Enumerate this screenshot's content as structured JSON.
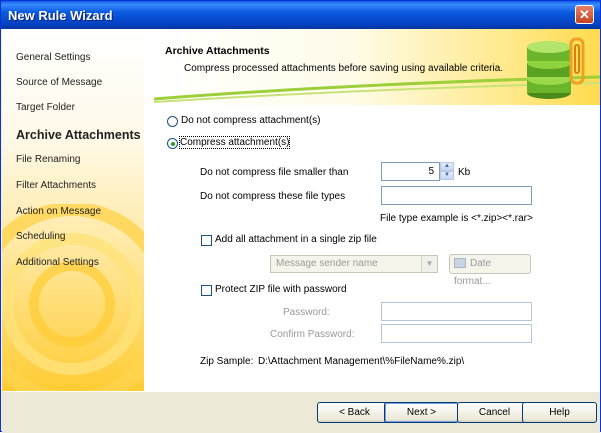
{
  "window": {
    "title": "New Rule Wizard",
    "close_glyph": "✕"
  },
  "sidebar": {
    "items": [
      {
        "label": "General Settings"
      },
      {
        "label": "Source of Message"
      },
      {
        "label": "Target Folder"
      },
      {
        "label": "Archive Attachments",
        "active": true
      },
      {
        "label": "File Renaming"
      },
      {
        "label": "Filter Attachments"
      },
      {
        "label": "Action on Message"
      },
      {
        "label": "Scheduling"
      },
      {
        "label": "Additional Settings"
      }
    ]
  },
  "header": {
    "title": "Archive Attachments",
    "subtitle": "Compress processed attachments before saving using available criteria.",
    "icon": "archive-books-icon"
  },
  "options": {
    "no_compress_label": "Do not compress attachment(s)",
    "compress_label": "Compress attachment(s)",
    "selected": "compress",
    "min_size_label": "Do not compress file smaller than",
    "min_size_value": "5",
    "min_size_unit": "Kb",
    "exclude_types_label": "Do not compress these file types",
    "exclude_types_value": "",
    "file_type_hint": "File type example is <*.zip><*.rar>",
    "single_zip_label": "Add all attachment in a single zip file",
    "single_zip_checked": false,
    "zip_name_select": "Message sender name",
    "date_format_button": "Date format...",
    "protect_label": "Protect ZIP file with password",
    "protect_checked": false,
    "password_label": "Password:",
    "confirm_password_label": "Confirm Password:",
    "zip_sample_label": "Zip Sample:",
    "zip_sample_value": "D:\\Attachment Management\\%FileName%.zip\\"
  },
  "buttons": {
    "back": "< Back",
    "next": "Next >",
    "cancel": "Cancel",
    "help": "Help"
  },
  "colors": {
    "titlebar": "#0a5ce4",
    "accent": "#ffcc33",
    "selected_radio": "#21a121"
  }
}
